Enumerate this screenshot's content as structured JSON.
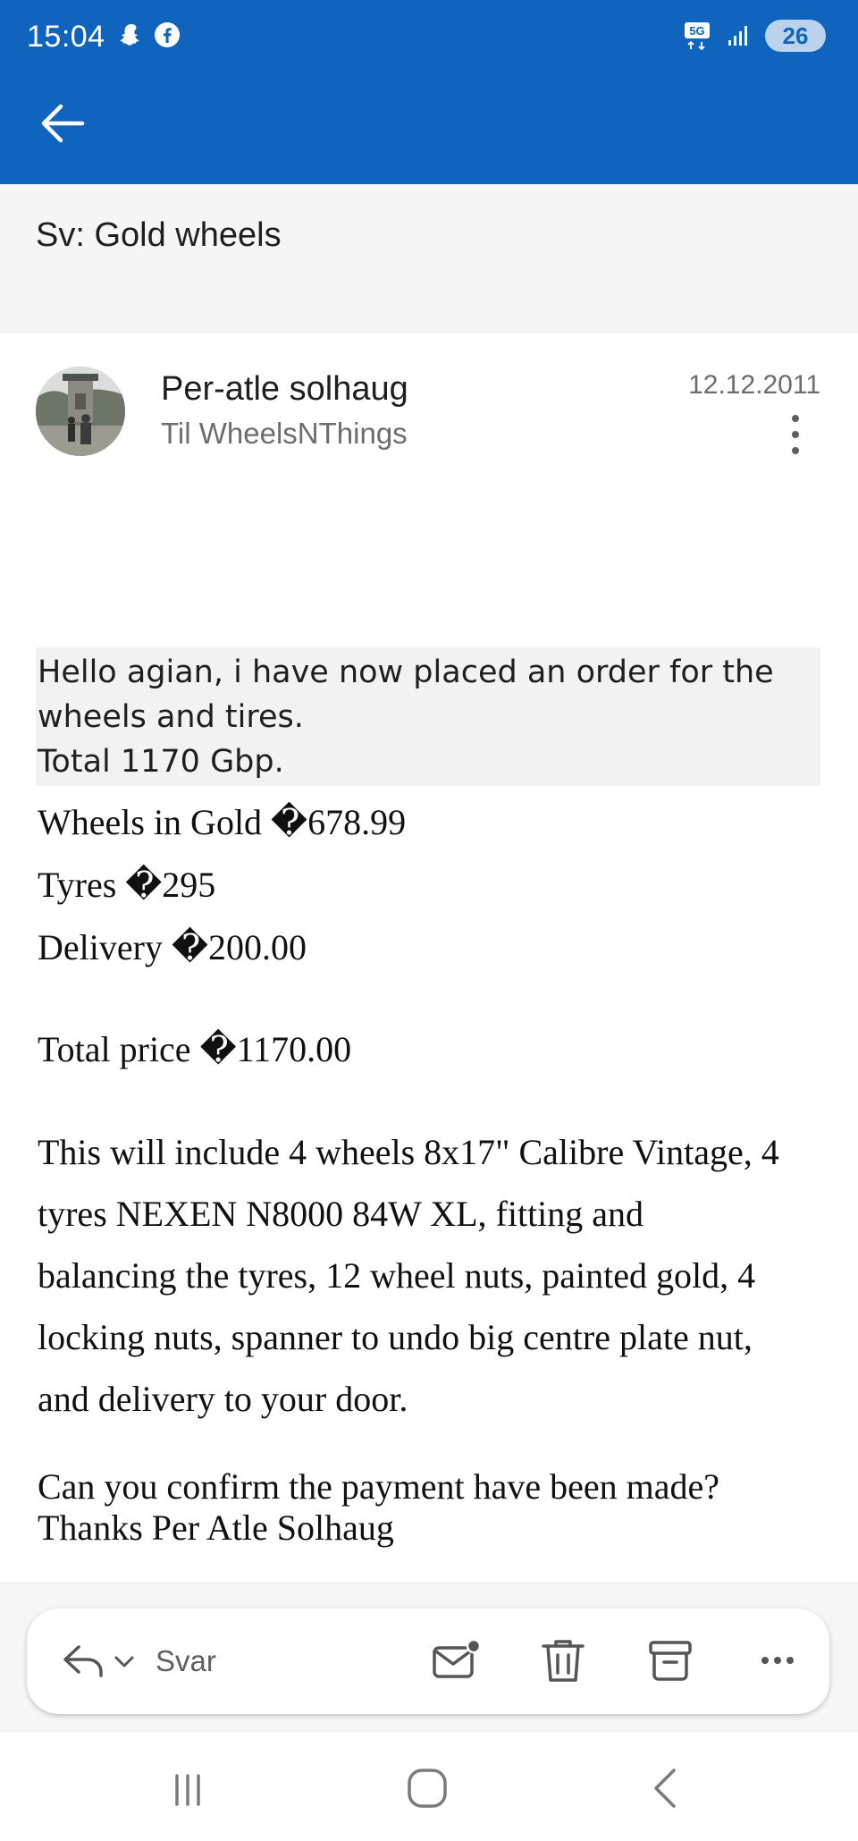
{
  "status_bar": {
    "time": "15:04",
    "left_icons": [
      "snapchat-icon",
      "facebook-icon"
    ],
    "network": "5G",
    "battery": "26"
  },
  "header": {
    "back_icon": "arrow-left-icon",
    "background_color": "#0f64be"
  },
  "email": {
    "subject": "Sv: Gold wheels",
    "sender_name": "Per-atle solhaug",
    "recipient": "Til WheelsNThings",
    "date": "12.12.2011",
    "body": {
      "highlight_lines": [
        "Hello agian, i have now placed an order for the",
        "wheels and tires.",
        "Total 1170 Gbp."
      ],
      "price_lines": [
        "Wheels in Gold �678.99",
        "Tyres �295",
        "Delivery �200.00"
      ],
      "total_line": "Total price �1170.00",
      "description_lines": [
        "This will include 4 wheels 8x17\" Calibre Vintage, 4",
        "tyres NEXEN N8000 84W XL, fitting and",
        "balancing the tyres, 12 wheel nuts, painted gold, 4",
        "locking nuts, spanner to undo big centre plate nut,",
        "and delivery to your door."
      ],
      "closing_lines": [
        "Can you confirm the payment have been made?",
        "Thanks Per Atle Solhaug"
      ]
    }
  },
  "action_bar": {
    "reply_label": "Svar",
    "icons": [
      "reply-icon",
      "chevron-down-icon",
      "mark-unread-icon",
      "trash-icon",
      "archive-icon",
      "more-icon"
    ]
  },
  "nav_bar": {
    "icons": [
      "recents-icon",
      "home-icon",
      "back-icon"
    ]
  }
}
